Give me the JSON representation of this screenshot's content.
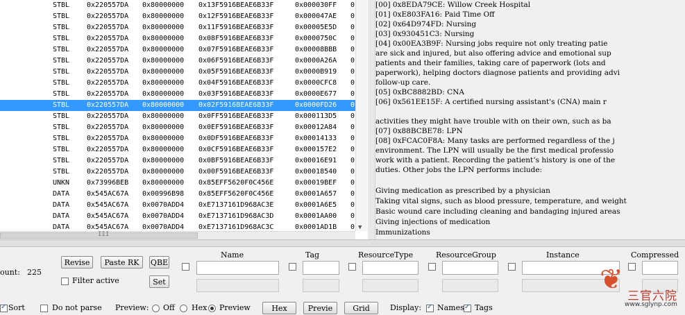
{
  "table": {
    "rows": [
      {
        "type": "STBL",
        "group": "0x220557DA",
        "flags": "0x80000000",
        "instance": "0x13F5916BEAE6B33F",
        "offset": "0x000030FF",
        "last": "0",
        "selected": false
      },
      {
        "type": "STBL",
        "group": "0x220557DA",
        "flags": "0x80000000",
        "instance": "0x12F5916BEAE6B33F",
        "offset": "0x000047AE",
        "last": "0",
        "selected": false
      },
      {
        "type": "STBL",
        "group": "0x220557DA",
        "flags": "0x80000000",
        "instance": "0x11F5916BEAE6B33F",
        "offset": "0x00005E5D",
        "last": "0",
        "selected": false
      },
      {
        "type": "STBL",
        "group": "0x220557DA",
        "flags": "0x80000000",
        "instance": "0x08F5916BEAE6B33F",
        "offset": "0x0000750C",
        "last": "0",
        "selected": false
      },
      {
        "type": "STBL",
        "group": "0x220557DA",
        "flags": "0x80000000",
        "instance": "0x07F5916BEAE6B33F",
        "offset": "0x00008BBB",
        "last": "0",
        "selected": false
      },
      {
        "type": "STBL",
        "group": "0x220557DA",
        "flags": "0x80000000",
        "instance": "0x06F5916BEAE6B33F",
        "offset": "0x0000A26A",
        "last": "0",
        "selected": false
      },
      {
        "type": "STBL",
        "group": "0x220557DA",
        "flags": "0x80000000",
        "instance": "0x05F5916BEAE6B33F",
        "offset": "0x0000B919",
        "last": "0",
        "selected": false
      },
      {
        "type": "STBL",
        "group": "0x220557DA",
        "flags": "0x80000000",
        "instance": "0x04F5916BEAE6B33F",
        "offset": "0x0000CFC8",
        "last": "0",
        "selected": false
      },
      {
        "type": "STBL",
        "group": "0x220557DA",
        "flags": "0x80000000",
        "instance": "0x03F5916BEAE6B33F",
        "offset": "0x0000E677",
        "last": "0",
        "selected": false
      },
      {
        "type": "STBL",
        "group": "0x220557DA",
        "flags": "0x80000000",
        "instance": "0x02F5916BEAE6B33F",
        "offset": "0x0000FD26",
        "last": "0",
        "selected": true
      },
      {
        "type": "STBL",
        "group": "0x220557DA",
        "flags": "0x80000000",
        "instance": "0x0FF5916BEAE6B33F",
        "offset": "0x000113D5",
        "last": "0",
        "selected": false
      },
      {
        "type": "STBL",
        "group": "0x220557DA",
        "flags": "0x80000000",
        "instance": "0x0EF5916BEAE6B33F",
        "offset": "0x00012A84",
        "last": "0",
        "selected": false
      },
      {
        "type": "STBL",
        "group": "0x220557DA",
        "flags": "0x80000000",
        "instance": "0x0DF5916BEAE6B33F",
        "offset": "0x00014133",
        "last": "0",
        "selected": false
      },
      {
        "type": "STBL",
        "group": "0x220557DA",
        "flags": "0x80000000",
        "instance": "0x0CF5916BEAE6B33F",
        "offset": "0x000157E2",
        "last": "0",
        "selected": false
      },
      {
        "type": "STBL",
        "group": "0x220557DA",
        "flags": "0x80000000",
        "instance": "0x0BF5916BEAE6B33F",
        "offset": "0x00016E91",
        "last": "0",
        "selected": false
      },
      {
        "type": "STBL",
        "group": "0x220557DA",
        "flags": "0x80000000",
        "instance": "0x00F5916BEAE6B33F",
        "offset": "0x00018540",
        "last": "0",
        "selected": false
      },
      {
        "type": "UNKN",
        "group": "0x73996BEB",
        "flags": "0x80000000",
        "instance": "0x85EFF5620F0C456E",
        "offset": "0x00019BEF",
        "last": "0",
        "selected": false
      },
      {
        "type": "DATA",
        "group": "0x545AC67A",
        "flags": "0x00996B98",
        "instance": "0x85EFF5620F0C456E",
        "offset": "0x0001A657",
        "last": "0",
        "selected": false
      },
      {
        "type": "DATA",
        "group": "0x545AC67A",
        "flags": "0x0070ADD4",
        "instance": "0xE7137161D968AC3E",
        "offset": "0x0001A6E5",
        "last": "0",
        "selected": false
      },
      {
        "type": "DATA",
        "group": "0x545AC67A",
        "flags": "0x0070ADD4",
        "instance": "0xE7137161D968AC3D",
        "offset": "0x0001AA00",
        "last": "0",
        "selected": false
      },
      {
        "type": "DATA",
        "group": "0x545AC67A",
        "flags": "0x0070ADD4",
        "instance": "0xE7137161D968AC3C",
        "offset": "0x0001AD1B",
        "last": "0",
        "selected": false
      }
    ],
    "hscroll_grip": "III",
    "vscroll_arrow": "▼"
  },
  "preview": {
    "lines": [
      "    [00] 0x8EDA79CE: Willow Creek Hospital",
      "    [01] 0xE803FA16: Paid Time Off",
      "    [02] 0x64D974FD: Nursing",
      "    [03] 0x930451C3: Nursing",
      "    [04] 0x00EA3B9F: Nursing jobs require not only treating patie",
      "are sick and injured, but also offering advice and emotional sup",
      "patients and their families, taking care of paperwork (lots and",
      "paperwork), helping doctors diagnose patients and providing advi",
      "follow-up care.",
      "    [05] 0xBC8882BD: CNA",
      "    [06] 0x561EE15F: A certified nursing assistant's (CNA) main r",
      "",
      "activities they might have trouble with on their own, such as ba",
      "    [07] 0x88BCBE78: LPN",
      "    [08] 0xFCAC0F8A: Many tasks are performed regardless of the j",
      "environment. The LPN will usually be the first medical professio",
      "work with a patient. Recording the patient’s history is one of the",
      "duties. Other jobs the LPN performs include:",
      "",
      "Giving medication as prescribed by a physician",
      "Taking vital signs, such as blood pressure, temperature, and weight",
      "Basic wound care including cleaning and bandaging injured areas",
      "Giving injections of medication",
      "Immunizations"
    ]
  },
  "controls": {
    "count_label": "ount:",
    "count_value": "225",
    "revise": "Revise",
    "paste_rk": "Paste RK",
    "qbe": "QBE",
    "set": "Set",
    "filter_active": "Filter active",
    "headers": {
      "name": "Name",
      "tag": "Tag",
      "resource_type": "ResourceType",
      "resource_group": "ResourceGroup",
      "instance": "Instance",
      "compressed": "Compressed"
    },
    "sort": "Sort",
    "do_not_parse": "Do not parse",
    "preview_label": "Preview:",
    "opt_off": "Off",
    "opt_hex": "Hex",
    "opt_preview": "Preview",
    "btn_hex": "Hex",
    "btn_preview": "Previe",
    "btn_grid": "Grid",
    "display_label": "Display:",
    "names": "Names",
    "tags": "Tags"
  },
  "watermark": {
    "logo_text": "三官六院",
    "url": "www.sglynp.com"
  },
  "colors": {
    "selection": "#3399ff",
    "window_bg": "#f0f0f0"
  }
}
